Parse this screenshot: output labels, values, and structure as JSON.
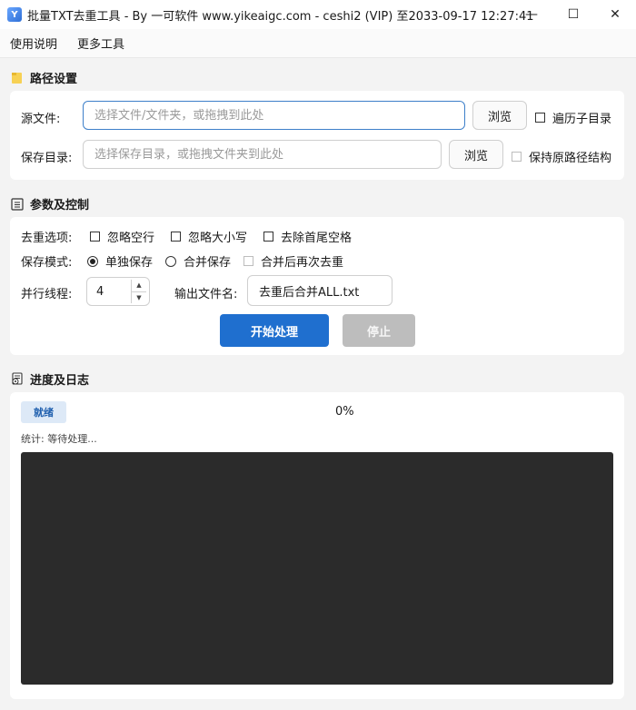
{
  "window": {
    "title": "批量TXT去重工具 - By 一可软件 www.yikeaigc.com - ceshi2 (VIP) 至2033-09-17 12:27:41",
    "app_icon_text": "Y",
    "min_glyph": "—",
    "max_glyph": "☐",
    "close_glyph": "✕"
  },
  "menu": {
    "items": [
      "使用说明",
      "更多工具"
    ]
  },
  "path_section": {
    "title": "路径设置",
    "source_label": "源文件:",
    "source_placeholder": "选择文件/文件夹，或拖拽到此处",
    "source_value": "",
    "browse_label": "浏览",
    "recursive_label": "遍历子目录",
    "save_label": "保存目录:",
    "save_placeholder": "选择保存目录，或拖拽文件夹到此处",
    "save_value": "",
    "browse2_label": "浏览",
    "keep_structure_label": "保持原路径结构"
  },
  "params_section": {
    "title": "参数及控制",
    "dedup_label": "去重选项:",
    "dedup_options": [
      "忽略空行",
      "忽略大小写",
      "去除首尾空格"
    ],
    "save_mode_label": "保存模式:",
    "save_modes": [
      "单独保存",
      "合并保存"
    ],
    "merge_dedup_label": "合并后再次去重",
    "threads_label": "并行线程:",
    "threads_value": "4",
    "output_name_label": "输出文件名:",
    "output_name_value": "去重后合并ALL.txt",
    "start_label": "开始处理",
    "stop_label": "停止"
  },
  "progress_section": {
    "title": "进度及日志",
    "status_badge": "就绪",
    "progress_text": "0%",
    "progress": 0,
    "stats_text": "统计: 等待处理..."
  }
}
